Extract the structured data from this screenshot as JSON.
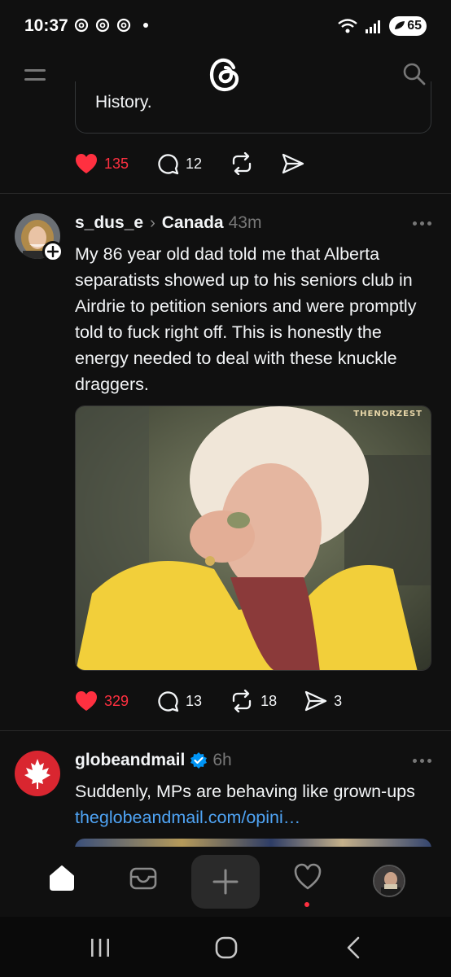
{
  "status_bar": {
    "time": "10:37",
    "battery": "65"
  },
  "feed": {
    "quote_snippet": "History.",
    "post0_actions": {
      "likes": "135",
      "replies": "12"
    },
    "post1": {
      "username": "s_dus_e",
      "topic": "Canada",
      "time": "43m",
      "text": "My 86 year old dad told me that Alberta separatists showed up to his seniors club in Airdrie to petition seniors and were promptly told to fuck right off. This is honestly the energy needed to deal with these knuckle draggers.",
      "media_label": "THENORZEST",
      "actions": {
        "likes": "329",
        "replies": "13",
        "reposts": "18",
        "shares": "3"
      }
    },
    "post2": {
      "username": "globeandmail",
      "time": "6h",
      "text": "Suddenly, MPs are behaving like grown-ups",
      "link": "theglobeandmail.com/opini…"
    }
  },
  "colors": {
    "background": "#101010",
    "like_red": "#ff3040",
    "link_blue": "#4fa4f5",
    "verified_blue": "#0095f6"
  }
}
